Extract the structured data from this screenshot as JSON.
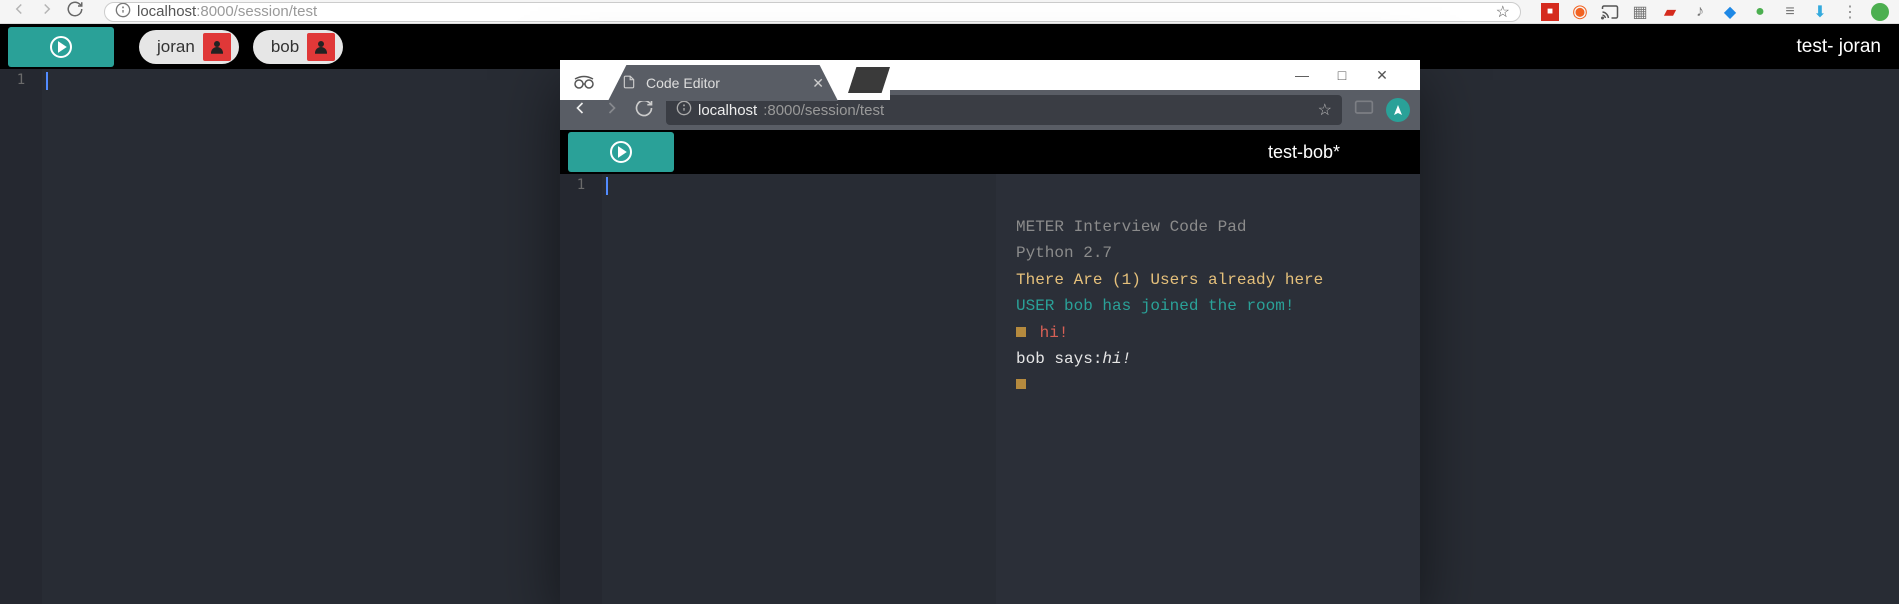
{
  "outer_browser": {
    "url_host": "localhost",
    "url_port_path": ":8000/session/test",
    "star_icon": "☆"
  },
  "outer_app": {
    "users": [
      {
        "name": "joran"
      },
      {
        "name": "bob"
      }
    ],
    "title_label": "test- joran",
    "gutter": {
      "line1": "1"
    }
  },
  "inner_window": {
    "window_controls": {
      "min": "—",
      "max": "□",
      "close": "✕"
    },
    "tab": {
      "title": "Code Editor",
      "close": "✕"
    },
    "url_host": "localhost",
    "url_port_path": ":8000/session/test",
    "star_icon": "☆"
  },
  "inner_app": {
    "title_label": "test-bob*",
    "gutter": {
      "line1": "1"
    },
    "console": {
      "line1": "METER Interview Code Pad",
      "line2": "Python 2.7",
      "line3": "There Are (1) Users already here",
      "line4": " USER bob has joined the room!",
      "line5_cmd": " hi!",
      "line6_prefix": "bob says:",
      "line6_msg": "hi!"
    }
  }
}
